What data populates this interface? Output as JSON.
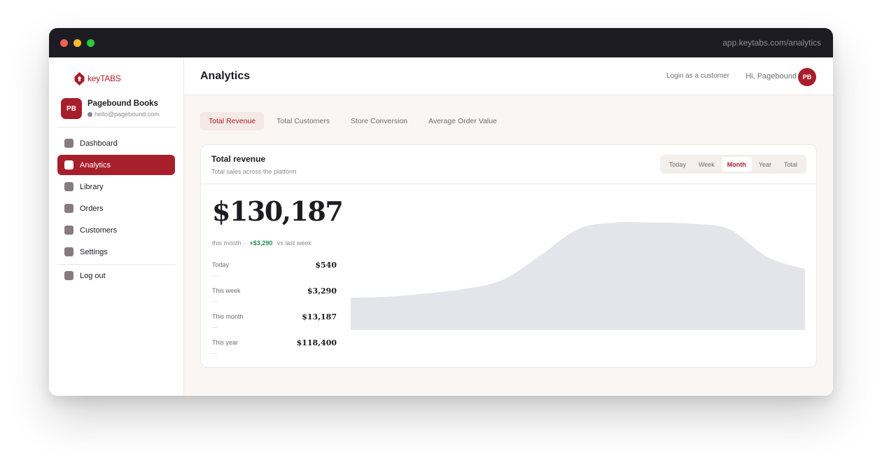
{
  "window": {
    "url": "app.keytabs.com/analytics",
    "traffic_lights": [
      "close",
      "minimize",
      "zoom"
    ]
  },
  "brand": {
    "name": "keyTABS",
    "accent_color": "#a81f2c"
  },
  "account": {
    "initials": "PB",
    "name": "Pagebound Books",
    "email": "hello@pagebound.com"
  },
  "sidebar": {
    "items": [
      {
        "label": "Dashboard",
        "active": false
      },
      {
        "label": "Analytics",
        "active": true
      },
      {
        "label": "Library",
        "active": false
      },
      {
        "label": "Orders",
        "active": false
      },
      {
        "label": "Customers",
        "active": false
      },
      {
        "label": "Settings",
        "active": false
      }
    ],
    "logout_label": "Log out"
  },
  "header": {
    "title": "Analytics",
    "login_link": "Login as a customer",
    "greeting": "Hi, Pagebound",
    "avatar_initials": "PB"
  },
  "tabs": [
    {
      "label": "Total Revenue",
      "active": true
    },
    {
      "label": "Total Customers",
      "active": false
    },
    {
      "label": "Store Conversion",
      "active": false
    },
    {
      "label": "Average Order Value",
      "active": false
    }
  ],
  "card": {
    "title": "Total revenue",
    "subtitle": "Total sales across the platform",
    "periods": [
      {
        "label": "Today",
        "active": false
      },
      {
        "label": "Week",
        "active": false
      },
      {
        "label": "Month",
        "active": true
      },
      {
        "label": "Year",
        "active": false
      },
      {
        "label": "Total",
        "active": false
      }
    ],
    "total": "$130,187",
    "period_text": "this month ·",
    "delta": "+$3,290",
    "delta_suffix": "vs last week",
    "delta_color": "#2a8a58",
    "stats": [
      {
        "label": "Today",
        "value": "$540",
        "dash": "—"
      },
      {
        "label": "This week",
        "value": "$3,290",
        "dash": "—"
      },
      {
        "label": "This month",
        "value": "$13,187",
        "dash": "—"
      },
      {
        "label": "This year",
        "value": "$118,400",
        "dash": "—"
      }
    ]
  },
  "chart_data": {
    "type": "area",
    "title": "",
    "xlabel": "",
    "ylabel": "",
    "grid": false,
    "fill_color": "#e4e5ea",
    "x": [
      0,
      1,
      2,
      3,
      4,
      5,
      6,
      7,
      8,
      9,
      10,
      11,
      12
    ],
    "values": [
      0.29,
      0.3,
      0.33,
      0.37,
      0.45,
      0.67,
      0.91,
      0.97,
      0.97,
      0.96,
      0.91,
      0.66,
      0.55
    ],
    "ylim": [
      0,
      1
    ]
  }
}
